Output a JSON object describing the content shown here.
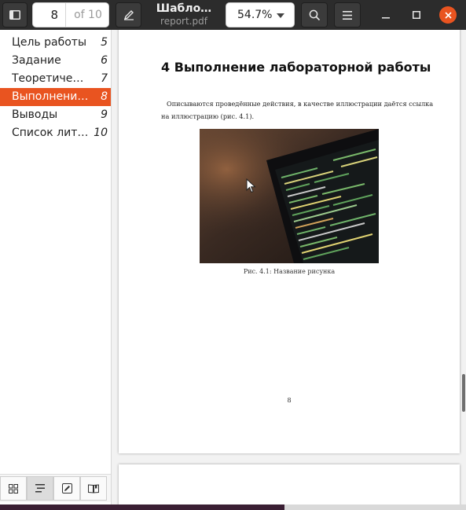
{
  "header": {
    "page_number": "8",
    "page_total": "of 10",
    "title": "Шабло…",
    "filename": "report.pdf",
    "zoom": "54.7%"
  },
  "sidebar": {
    "items": [
      {
        "label": "Цель работы",
        "page": "5"
      },
      {
        "label": "Задание",
        "page": "6"
      },
      {
        "label": "Теоретичес…",
        "page": "7"
      },
      {
        "label": "Выполнени…",
        "page": "8"
      },
      {
        "label": "Выводы",
        "page": "9"
      },
      {
        "label": "Список лит…",
        "page": "10"
      }
    ],
    "active_index": 3
  },
  "document": {
    "section_title": "4  Выполнение лабораторной работы",
    "paragraph_line1": "Описываются проведённые действия, в качестве иллюстрации даётся ссылка",
    "paragraph_line2": "на иллюстрацию (рис. 4.1).",
    "caption": "Рис. 4.1: Название рисунка",
    "page_number": "8"
  },
  "colors": {
    "accent": "#e95420",
    "header_bg": "#2c2c2c"
  },
  "icons": [
    "sidebar-toggle-icon",
    "annotate-pen-icon",
    "search-icon",
    "menu-icon",
    "minimize-icon",
    "maximize-icon",
    "close-icon",
    "thumbnails-icon",
    "outline-icon",
    "annotations-icon",
    "bookmarks-icon"
  ]
}
